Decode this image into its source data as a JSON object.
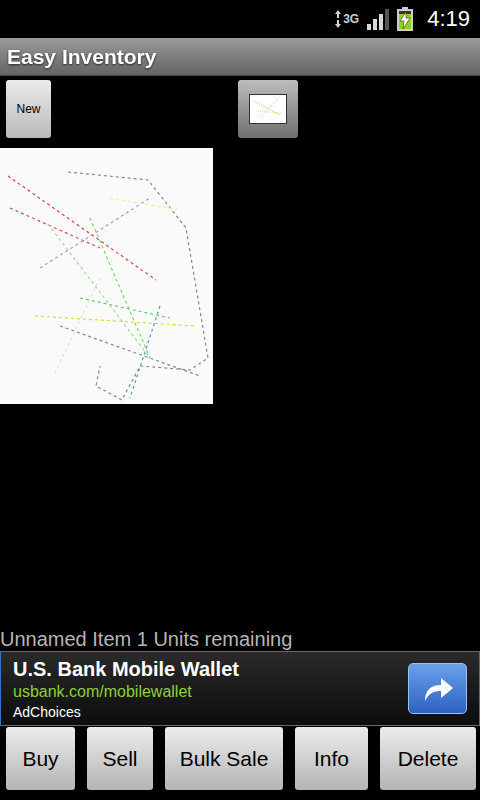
{
  "status_bar": {
    "network": "3G",
    "signal_level": 0.75,
    "battery_level": 0.85,
    "charging": true,
    "time": "4:19"
  },
  "title": "Easy Inventory",
  "toolbar": {
    "new_button": "New"
  },
  "item": {
    "label": "Unnamed Item 1 Units remaining"
  },
  "ad": {
    "title": "U.S. Bank Mobile Wallet",
    "url": "usbank.com/mobilewallet",
    "adchoices": "AdChoices"
  },
  "buttons": [
    "Buy",
    "Sell",
    "Bulk Sale",
    "Info",
    "Delete"
  ]
}
